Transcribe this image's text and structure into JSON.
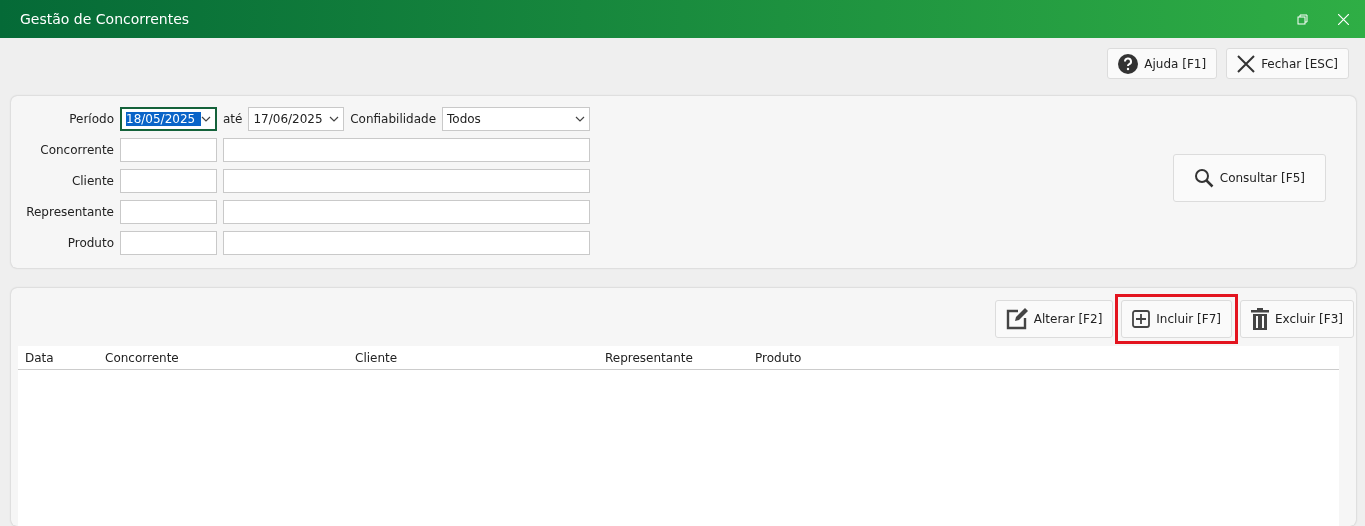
{
  "window": {
    "title": "Gestão de Concorrentes"
  },
  "top_buttons": [
    {
      "kind": "help",
      "label": "Ajuda [F1]"
    },
    {
      "kind": "close",
      "label": "Fechar [ESC]"
    }
  ],
  "filters": {
    "period": {
      "label": "Período",
      "from": {
        "value": "18/05/2025",
        "focused": true
      },
      "separator": "até",
      "to": {
        "value": "17/06/2025",
        "focused": false
      }
    },
    "reliability": {
      "label": "Confiabilidade",
      "value": "Todos"
    },
    "lookups": [
      {
        "label": "Concorrente"
      },
      {
        "label": "Cliente"
      },
      {
        "label": "Representante"
      },
      {
        "label": "Produto"
      }
    ],
    "search_button": {
      "label": "Consultar [F5]"
    }
  },
  "actions": [
    {
      "kind": "edit",
      "label": "Alterar [F2]",
      "highlighted": false
    },
    {
      "kind": "add",
      "label": "Incluir [F7]",
      "highlighted": true
    },
    {
      "kind": "delete",
      "label": "Excluir [F3]",
      "highlighted": false
    }
  ],
  "table": {
    "columns": [
      "Data",
      "Concorrente",
      "Cliente",
      "Representante",
      "Produto"
    ]
  }
}
